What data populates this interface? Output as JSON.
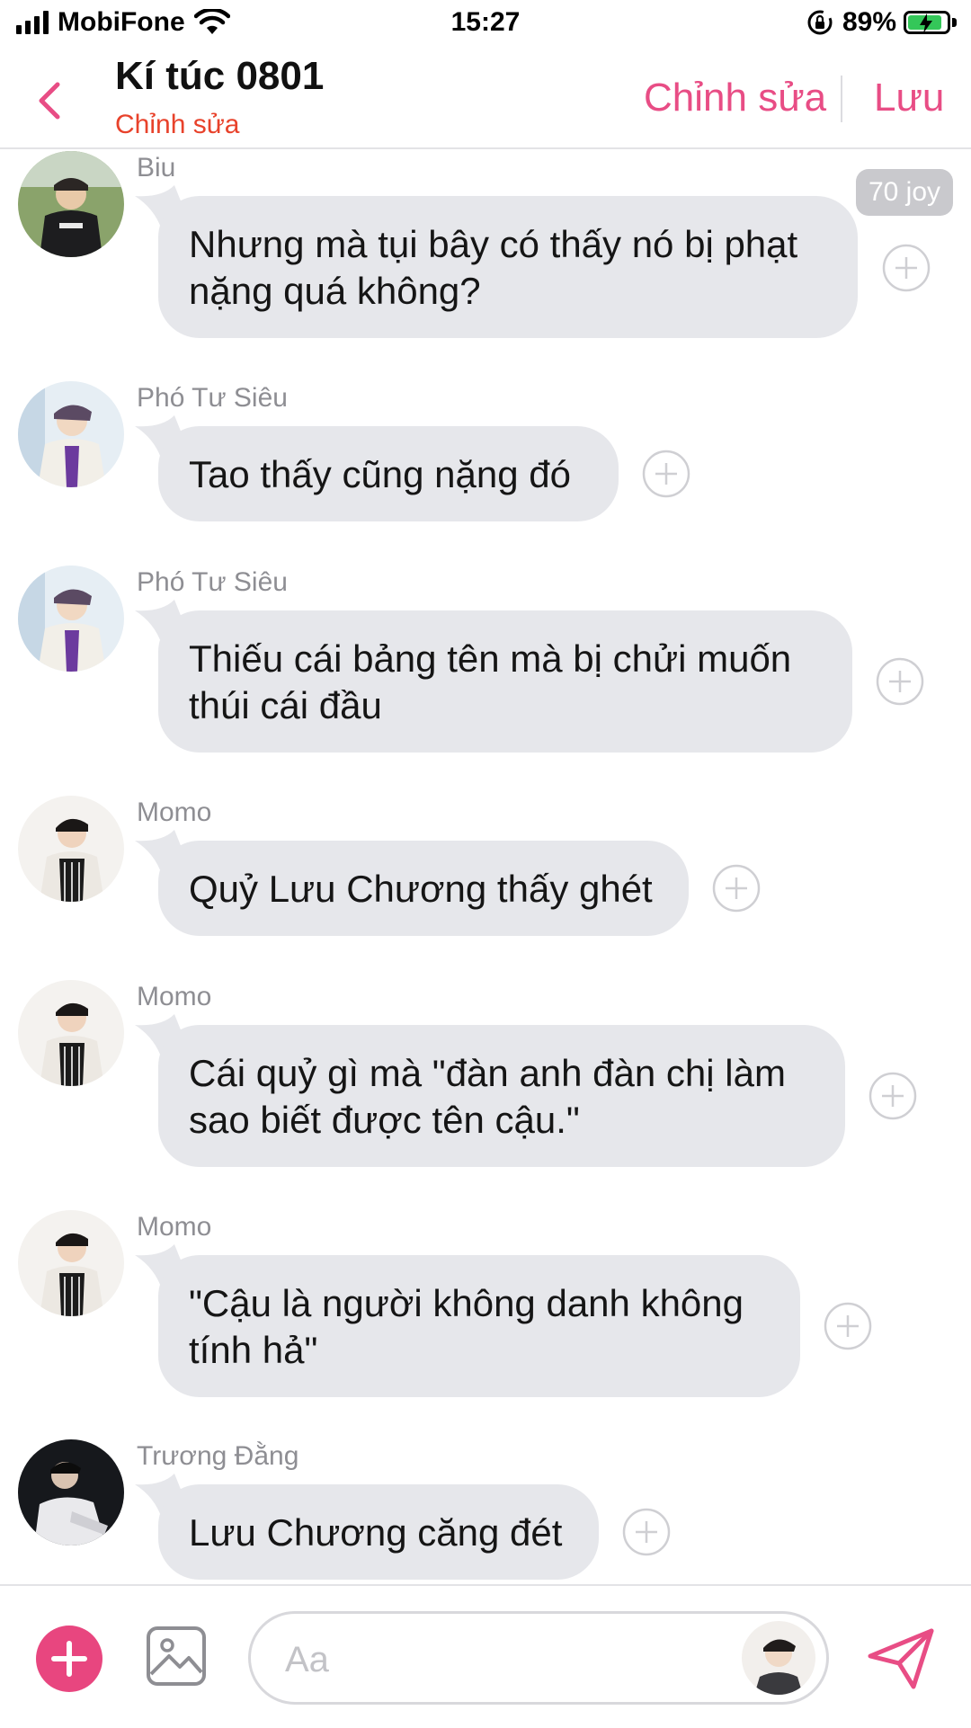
{
  "status_bar": {
    "carrier": "MobiFone",
    "time": "15:27",
    "battery_percent": "89%",
    "battery_level": 0.89,
    "icons": [
      "signal-icon",
      "wifi-icon",
      "orientation-lock-icon",
      "battery-charging-icon"
    ]
  },
  "header": {
    "back_icon": "chevron-left-icon",
    "title": "Kí túc 0801",
    "subtitle": "Chỉnh sửa",
    "edit_label": "Chỉnh sửa",
    "save_label": "Lưu",
    "accent": "#e84d85",
    "subtitle_color": "#e8422b"
  },
  "joy_badge": "70 joy",
  "messages": [
    {
      "sender": "Biu",
      "text": "Nhưng mà tụi bây có thấy nó bị phạt nặng quá không?"
    },
    {
      "sender": "Phó Tư Siêu",
      "text": "Tao thấy cũng nặng đó"
    },
    {
      "sender": "Phó Tư Siêu",
      "text": "Thiếu cái bảng tên mà bị chửi muốn thúi cái đầu"
    },
    {
      "sender": "Momo",
      "text": "Quỷ Lưu Chương thấy ghét"
    },
    {
      "sender": "Momo",
      "text": "Cái quỷ gì mà \"đàn anh đàn chị làm sao biết được tên cậu.\""
    },
    {
      "sender": "Momo",
      "text": "\"Cậu là người không danh không tính hả\""
    },
    {
      "sender": "Trương Đằng",
      "text": "Lưu Chương căng đét"
    }
  ],
  "composer": {
    "placeholder": "Aa",
    "value": "",
    "icons": [
      "plus-icon",
      "image-icon",
      "send-icon"
    ]
  },
  "colors": {
    "bubble": "#e6e7eb",
    "add_button": "#e8467f",
    "sender": "#8e8e93"
  }
}
